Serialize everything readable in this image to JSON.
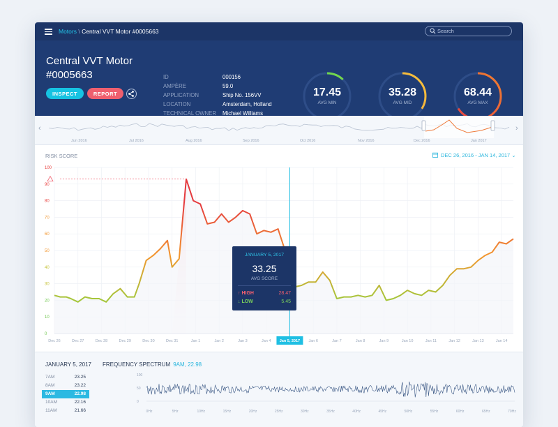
{
  "breadcrumb": {
    "root": "Motors",
    "sep": "\\",
    "current": "Central VVT Motor #0005663"
  },
  "search": {
    "placeholder": "Search"
  },
  "header": {
    "title": "Central VVT Motor #0005663",
    "inspect_label": "INSPECT",
    "report_label": "REPORT",
    "meta": [
      {
        "label": "ID",
        "value": "000156"
      },
      {
        "label": "AMPÈRE",
        "value": "59.0"
      },
      {
        "label": "APPLICATION",
        "value": "Ship No. 156VV"
      },
      {
        "label": "LOCATION",
        "value": "Amsterdam, Holland"
      },
      {
        "label": "TECHNICAL OWNER",
        "value": "Michael Williams"
      }
    ],
    "gauges": [
      {
        "value": "17.45",
        "label": "AVG MIN",
        "fraction": 0.12,
        "color_start": "#3ccf5a",
        "color_end": "#7fd94a"
      },
      {
        "value": "35.28",
        "label": "AVG MID",
        "fraction": 0.34,
        "color_start": "#f2a13a",
        "color_end": "#f6c23c"
      },
      {
        "value": "68.44",
        "label": "AVG MAX",
        "fraction": 0.66,
        "color_start": "#e8413f",
        "color_end": "#f0802f"
      }
    ]
  },
  "overview": {
    "months": [
      "Jun 2016",
      "Jul 2016",
      "Aug 2016",
      "Sep 2016",
      "Oct 2016",
      "Nov 2016",
      "Dec 2016",
      "Jan 2017"
    ]
  },
  "chart": {
    "label": "RISK SCORE",
    "date_range": "DEC 26, 2016 - JAN 14, 2017",
    "threshold_marker_value": 93
  },
  "chart_data": {
    "type": "line",
    "title": "RISK SCORE",
    "ylim": [
      0,
      100
    ],
    "y_ticks": [
      0,
      10,
      20,
      30,
      40,
      50,
      60,
      70,
      80,
      90,
      100
    ],
    "x_ticks": [
      "Dec 26",
      "Dec 27",
      "Dec 28",
      "Dec 29",
      "Dec 30",
      "Dec 31",
      "Jan 1",
      "Jan 2",
      "Jan 3",
      "Jan 4",
      "Jan 5, 2017",
      "Jan 6",
      "Jan 7",
      "Jan 8",
      "Jan 9",
      "Jan 10",
      "Jan 11",
      "Jan 12",
      "Jan 13",
      "Jan 14"
    ],
    "selected_tick": 10,
    "x": [
      0.0,
      0.25,
      0.5,
      0.7,
      1.0,
      1.3,
      1.6,
      1.9,
      2.2,
      2.5,
      2.8,
      3.1,
      3.4,
      3.6,
      3.9,
      4.2,
      4.5,
      4.8,
      5.0,
      5.3,
      5.6,
      5.9,
      6.2,
      6.5,
      6.8,
      7.1,
      7.4,
      7.7,
      8.0,
      8.3,
      8.6,
      8.9,
      9.2,
      9.5,
      9.8,
      10.0,
      10.2,
      10.5,
      10.8,
      11.1,
      11.4,
      11.7,
      12.0,
      12.3,
      12.6,
      12.9,
      13.2,
      13.5,
      13.8,
      14.1,
      14.4,
      14.7,
      15.0,
      15.3,
      15.6,
      15.9,
      16.2,
      16.5,
      16.8,
      17.1,
      17.4,
      17.7,
      18.0,
      18.3,
      18.6,
      18.9,
      19.2,
      19.5
    ],
    "series": [
      {
        "values": [
          23,
          22,
          22,
          21,
          19,
          22,
          21,
          21,
          19,
          24,
          27,
          22,
          22,
          30,
          44,
          47,
          51,
          56,
          40,
          45,
          93,
          80,
          78,
          66,
          67,
          72,
          67,
          70,
          74,
          72,
          60,
          62,
          61,
          63,
          50,
          33.25,
          28,
          29,
          31,
          31,
          37,
          32,
          21,
          22,
          22,
          23,
          22,
          23,
          29,
          20,
          21,
          23,
          26,
          24,
          23,
          26,
          25,
          29,
          35,
          39,
          39,
          40,
          44,
          47,
          49,
          55,
          54,
          57
        ]
      }
    ],
    "tooltip": {
      "date": "JANUARY 5, 2017",
      "value": "33.25",
      "sub": "AVG SCORE",
      "high_label": "↑ HIGH",
      "high_value": "28.47",
      "low_label": "↓ LOW",
      "low_value": "5.45"
    }
  },
  "bottom": {
    "date": "JANUARY 5, 2017",
    "rows": [
      {
        "time": "7AM",
        "value": "23.25"
      },
      {
        "time": "8AM",
        "value": "23.22"
      },
      {
        "time": "9AM",
        "value": "22.98",
        "selected": true
      },
      {
        "time": "10AM",
        "value": "22.16"
      },
      {
        "time": "11AM",
        "value": "21.66"
      }
    ],
    "freq_title": "FREQUENCY SPECTRUM",
    "freq_selected": "9AM, 22.98",
    "freq_y_ticks": [
      "100",
      "50",
      "0"
    ],
    "freq_x_ticks": [
      "0Hz",
      "5Hz",
      "10Hz",
      "15Hz",
      "20Hz",
      "25Hz",
      "30Hz",
      "35Hz",
      "40Hz",
      "45Hz",
      "50Hz",
      "55Hz",
      "60Hz",
      "65Hz",
      "70Hz"
    ]
  },
  "colors": {
    "brand_dark": "#1c3567",
    "header_bg": "#1f3c74",
    "accent_cyan": "#16c3e2",
    "accent_red": "#ef5f6e"
  }
}
